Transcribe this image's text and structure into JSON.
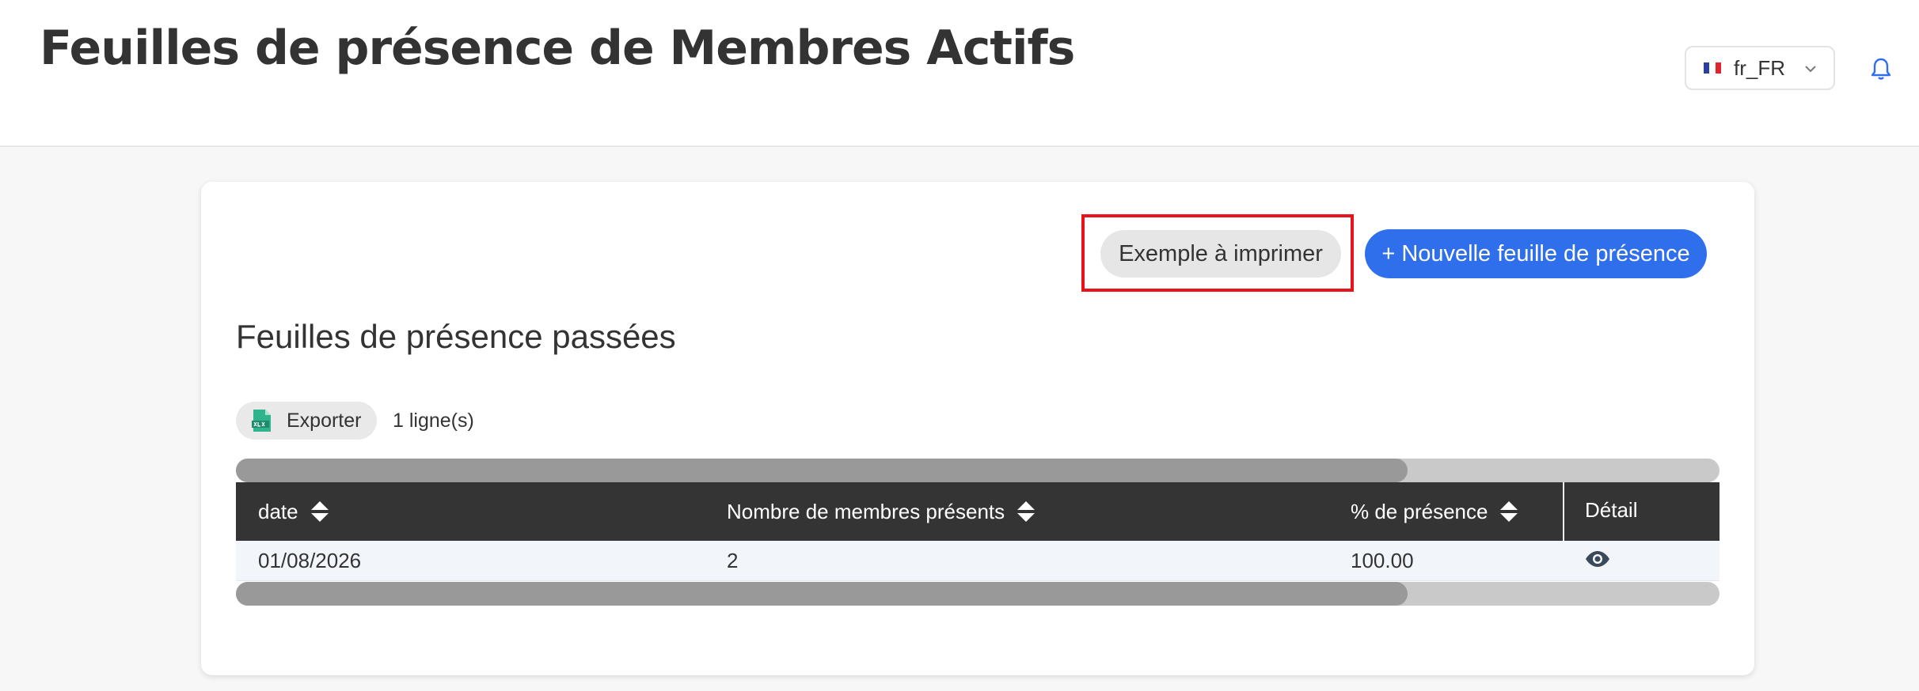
{
  "header": {
    "title": "Feuilles de présence de Membres Actifs",
    "language": "fr_FR"
  },
  "actions": {
    "print_example_label": "Exemple à imprimer",
    "new_sheet_label": "+ Nouvelle feuille de présence"
  },
  "section": {
    "title": "Feuilles de présence passées"
  },
  "toolbar": {
    "export_label": "Exporter",
    "row_count": "1 ligne(s)"
  },
  "table": {
    "columns": [
      "date",
      "Nombre de membres présents",
      "% de présence",
      "Détail"
    ],
    "rows": [
      {
        "date": "01/08/2026",
        "members_present": "2",
        "presence_pct": "100.00"
      }
    ],
    "scroll_position_fraction": 0.79
  },
  "colors": {
    "primary": "#2f6fec",
    "table_header": "#343434",
    "highlight_frame": "#e8131b"
  }
}
